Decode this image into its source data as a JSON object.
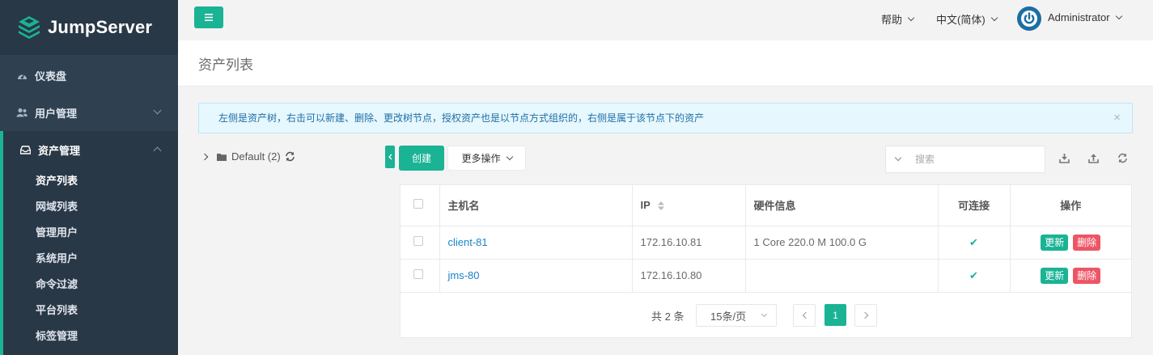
{
  "app": {
    "brand": "JumpServer"
  },
  "sidebar": {
    "items": [
      {
        "label": "仪表盘",
        "icon": "dashboard-icon"
      },
      {
        "label": "用户管理",
        "icon": "users-icon"
      },
      {
        "label": "资产管理",
        "icon": "inbox-icon"
      }
    ],
    "subitems": [
      "资产列表",
      "网域列表",
      "管理用户",
      "系统用户",
      "命令过滤",
      "平台列表",
      "标签管理"
    ]
  },
  "topbar": {
    "help": "帮助",
    "language": "中文(简体)",
    "user": "Administrator"
  },
  "page": {
    "title": "资产列表",
    "alert": "左侧是资产树，右击可以新建、删除、更改树节点，授权资产也是以节点方式组织的，右侧是属于该节点下的资产",
    "alert_close": "×"
  },
  "tree": {
    "node_label": "Default (2)"
  },
  "toolbar": {
    "create": "创建",
    "more": "更多操作",
    "search_placeholder": "搜索"
  },
  "table": {
    "headers": [
      "主机名",
      "IP",
      "硬件信息",
      "可连接",
      "操作"
    ],
    "rows": [
      {
        "hostname": "client-81",
        "ip": "172.16.10.81",
        "hardware": "1 Core 220.0 M 100.0 G",
        "connectable": "✔",
        "update": "更新",
        "delete": "删除"
      },
      {
        "hostname": "jms-80",
        "ip": "172.16.10.80",
        "hardware": "",
        "connectable": "✔",
        "update": "更新",
        "delete": "删除"
      }
    ]
  },
  "pagination": {
    "total": "共 2 条",
    "page_size": "15条/页",
    "current": "1"
  },
  "colors": {
    "accent": "#1ab394",
    "sidebar": "#2f4050",
    "danger": "#ed5565",
    "link": "#1c84c6"
  }
}
